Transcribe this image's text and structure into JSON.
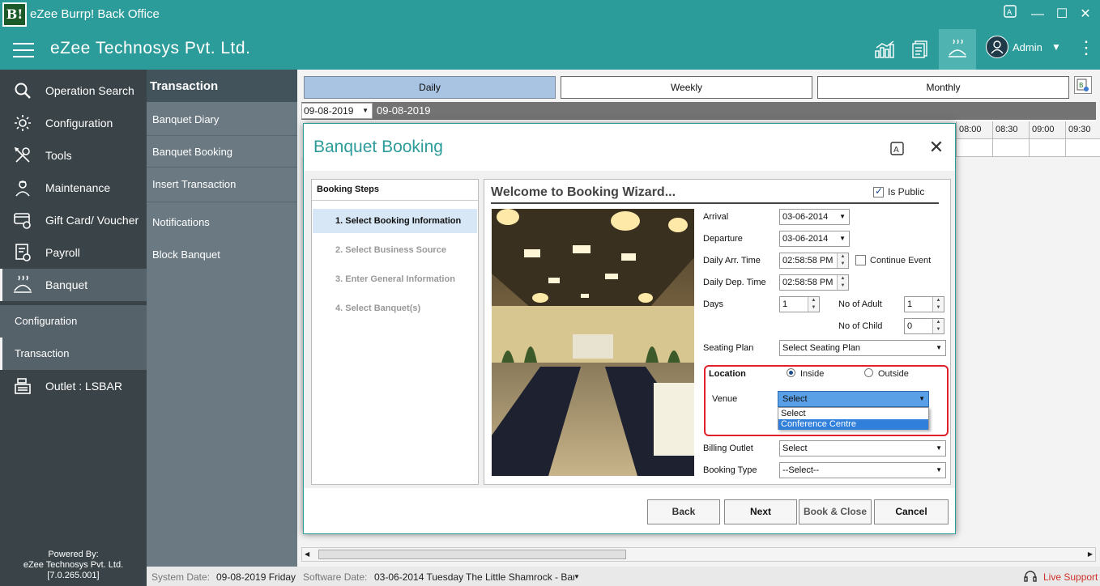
{
  "window": {
    "app_icon_text": "B!",
    "title": "eZee Burrp! Back Office"
  },
  "header": {
    "company": "eZee Technosys Pvt. Ltd.",
    "user": "Admin"
  },
  "sidebar": {
    "items": [
      {
        "label": "Operation Search",
        "icon": "search-icon"
      },
      {
        "label": "Configuration",
        "icon": "gear-icon"
      },
      {
        "label": "Tools",
        "icon": "tools-icon"
      },
      {
        "label": "Maintenance",
        "icon": "maintenance-icon"
      },
      {
        "label": "Gift Card/ Voucher",
        "icon": "gift-card-icon"
      },
      {
        "label": "Payroll",
        "icon": "payroll-icon"
      },
      {
        "label": "Banquet",
        "icon": "banquet-icon"
      },
      {
        "label": "Outlet : LSBAR",
        "icon": "register-icon"
      }
    ],
    "sub_items": [
      "Configuration",
      "Transaction"
    ],
    "powered_by": {
      "line1": "Powered By:",
      "line2": "eZee Technosys Pvt. Ltd.",
      "line3": "[7.0.265.001]"
    }
  },
  "submenu": {
    "title": "Transaction",
    "items": [
      "Banquet Diary",
      "Banquet Booking",
      "Insert Transaction",
      "Notifications",
      "Block Banquet"
    ]
  },
  "main": {
    "tabs": [
      "Daily",
      "Weekly",
      "Monthly"
    ],
    "active_tab": "Daily",
    "date_value": "09-08-2019",
    "date_label": "09-08-2019",
    "times": [
      "08:00",
      "08:30",
      "09:00",
      "09:30"
    ]
  },
  "status": {
    "system_date_label": "System Date:",
    "system_date": "09-08-2019 Friday",
    "software_date_label": "Software Date:",
    "software_date": "03-06-2014 Tuesday",
    "outlet": "The Little Shamrock - Bar",
    "live_support": "Live Support"
  },
  "dialog": {
    "title": "Banquet Booking",
    "steps_title": "Booking Steps",
    "steps": [
      "1.  Select Booking Information",
      "2.  Select Business Source",
      "3.  Enter General Information",
      "4.  Select Banquet(s)"
    ],
    "wizard_title": "Welcome to Booking Wizard...",
    "is_public_label": "Is Public",
    "fields": {
      "arrival_label": "Arrival",
      "arrival": "03-06-2014",
      "departure_label": "Departure",
      "departure": "03-06-2014",
      "daily_arr_label": "Daily Arr. Time",
      "daily_arr": "02:58:58 PM",
      "daily_dep_label": "Daily Dep. Time",
      "daily_dep": "02:58:58 PM",
      "continue_event_label": "Continue Event",
      "days_label": "Days",
      "days": "1",
      "adult_label": "No of Adult",
      "adult": "1",
      "child_label": "No of Child",
      "child": "0",
      "seating_label": "Seating Plan",
      "seating": "Select Seating Plan",
      "location_label": "Location",
      "location_inside": "Inside",
      "location_outside": "Outside",
      "venue_label": "Venue",
      "venue": "Select",
      "venue_options": [
        "Select",
        "Conference Centre"
      ],
      "billing_label": "Billing Outlet",
      "billing": "Select",
      "booking_type_label": "Booking Type",
      "booking_type": "--Select--"
    },
    "buttons": {
      "back": "Back",
      "next": "Next",
      "book_close": "Book & Close",
      "cancel": "Cancel"
    }
  },
  "colors": {
    "teal": "#2c9c9a",
    "sidebar": "#3a4448",
    "highlight_red": "#e0202b"
  }
}
